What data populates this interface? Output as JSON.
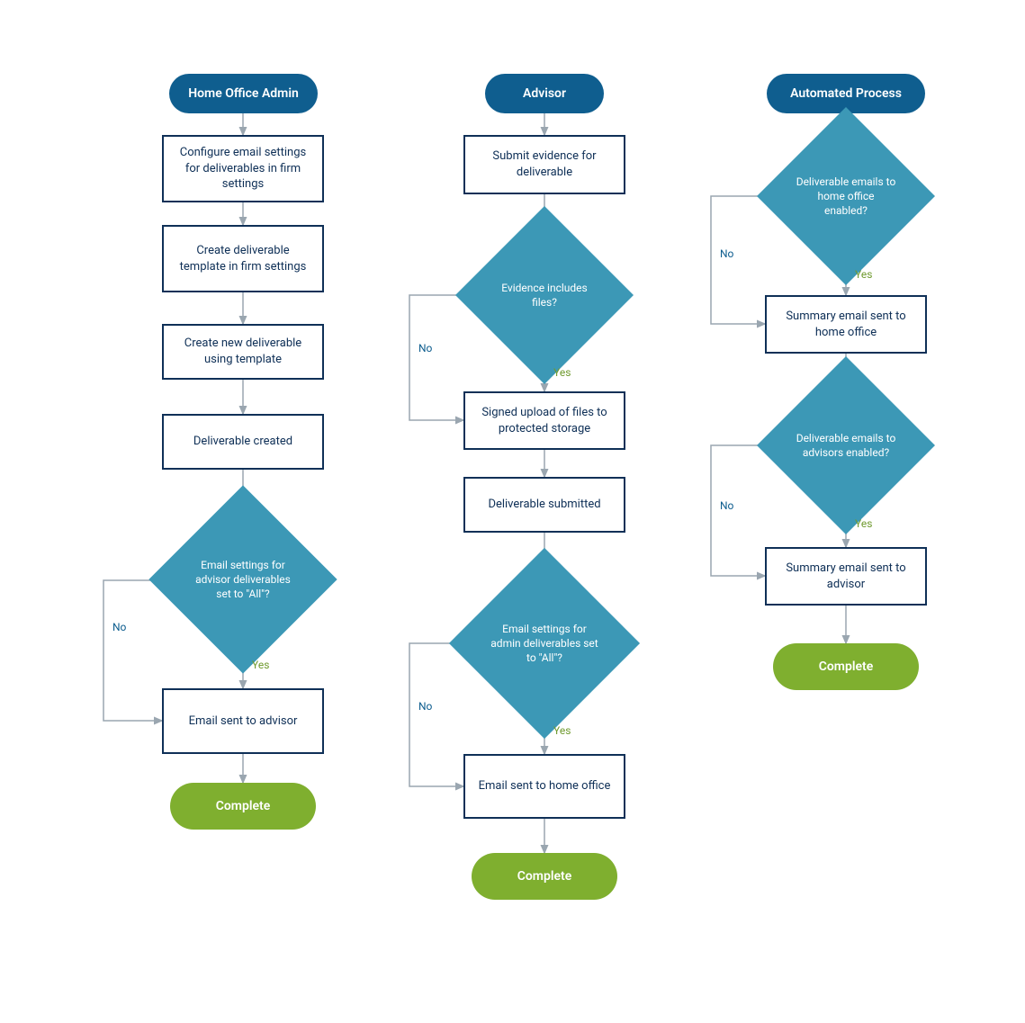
{
  "labels": {
    "yes": "Yes",
    "no": "No"
  },
  "lanes": {
    "admin": {
      "title": "Home Office Admin",
      "steps": {
        "configure": "Configure email settings for deliverables in firm settings",
        "createTemplate": "Create deliverable template in firm settings",
        "createDeliverable": "Create new deliverable using template",
        "deliverableCreated": "Deliverable created",
        "decision": "Email settings for advisor deliverables set to \"All\"?",
        "emailSent": "Email sent to advisor",
        "complete": "Complete"
      }
    },
    "advisor": {
      "title": "Advisor",
      "steps": {
        "submit": "Submit evidence for deliverable",
        "decisionFiles": "Evidence includes files?",
        "signedUpload": "Signed upload of files to protected storage",
        "submitted": "Deliverable submitted",
        "decisionAdminAll": "Email settings for admin deliverables set to \"All\"?",
        "emailSent": "Email sent to home office",
        "complete": "Complete"
      }
    },
    "auto": {
      "title": "Automated Process",
      "steps": {
        "decisionHome": "Deliverable emails to home office enabled?",
        "summaryHome": "Summary email sent to home office",
        "decisionAdvisors": "Deliverable emails to advisors enabled?",
        "summaryAdvisor": "Summary email sent to advisor",
        "complete": "Complete"
      }
    }
  }
}
